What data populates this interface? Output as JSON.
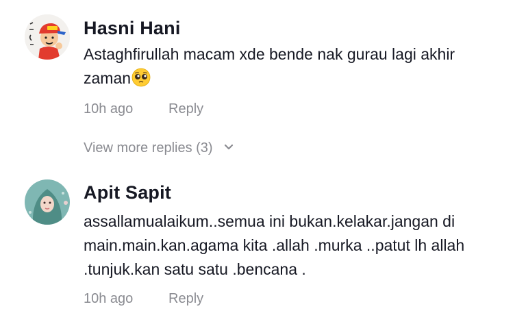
{
  "comments": [
    {
      "username": "Hasni Hani",
      "text_lines": [
        "Astaghfirullah macam xde bende nak gurau lagi akhir",
        "zaman"
      ],
      "emoji": "pleading-face",
      "time": "10h ago",
      "reply_label": "Reply",
      "avatar_icon": "cartoon-kid-avatar"
    },
    {
      "username": "Apit Sapit",
      "text_lines": [
        "assallamualaikum..semua ini bukan.kelakar.jangan di",
        "main.main.kan.agama kita .allah .murka ..patut lh allah",
        ".tunjuk.kan satu satu .bencana ."
      ],
      "time": "10h ago",
      "reply_label": "Reply",
      "avatar_icon": "hijab-woman-avatar"
    }
  ],
  "view_more": {
    "label": "View more replies (3)",
    "icon": "chevron-down-icon"
  },
  "colors": {
    "primary_text": "#161823",
    "secondary_text": "#8a8b91",
    "background": "#ffffff"
  }
}
